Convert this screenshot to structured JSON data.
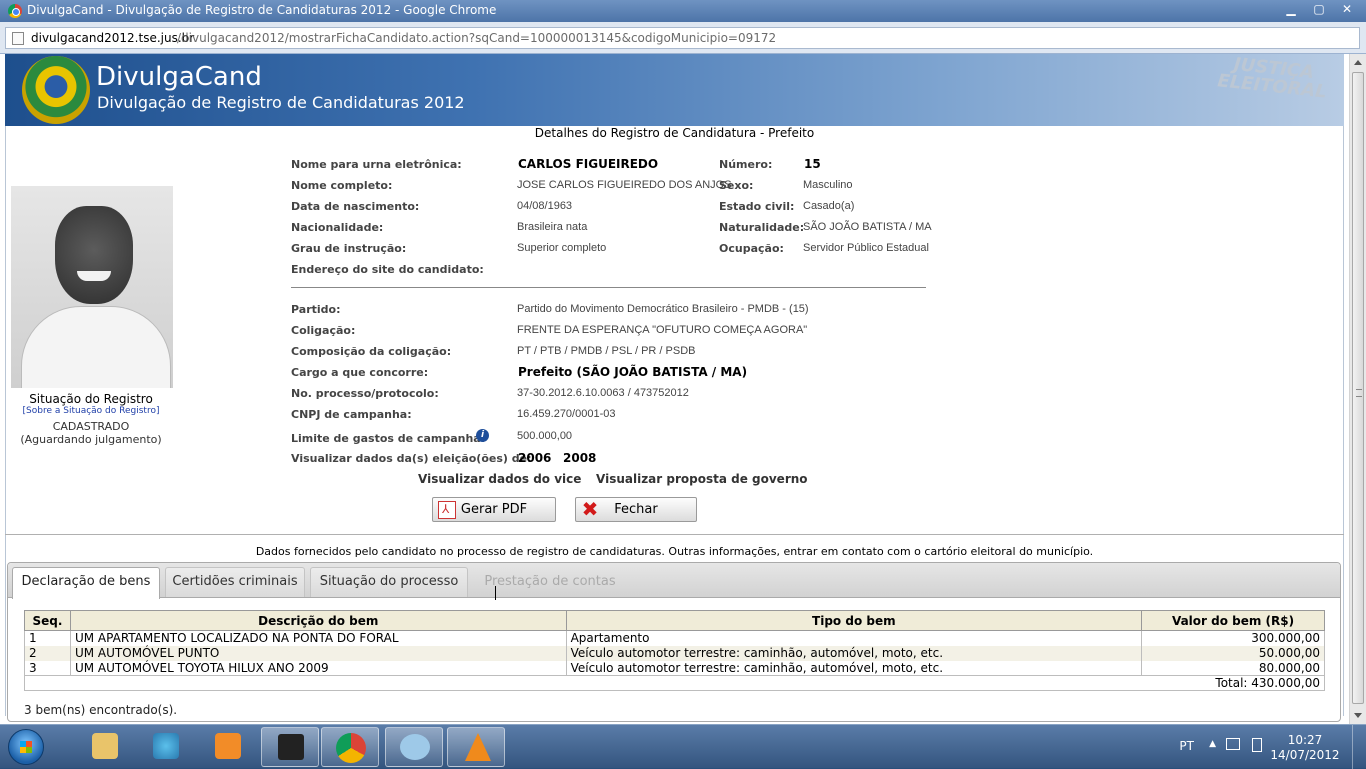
{
  "window": {
    "title": "DivulgaCand - Divulgação de Registro de Candidaturas 2012 - Google Chrome",
    "controls": {
      "minimize": "▁",
      "maximize": "▢",
      "close": "✕"
    }
  },
  "address": {
    "host": "divulgacand2012.tse.jus.br",
    "path": "/divulgacand2012/mostrarFichaCandidato.action?sqCand=100000013145&codigoMunicipio=09172"
  },
  "banner": {
    "app_name": "DivulgaCand",
    "subtitle": "Divulgação de Registro de Candidaturas 2012",
    "brand": "JUSTIÇA ELEITORAL"
  },
  "section_title": "Detalhes do Registro de Candidatura - Prefeito",
  "registration": {
    "title": "Situação do Registro",
    "link": "[Sobre a Situação do Registro]",
    "status": "CADASTRADO",
    "status_note": "(Aguardando julgamento)"
  },
  "candidate": {
    "ballot_name_label": "Nome para urna eletrônica:",
    "ballot_name": "CARLOS FIGUEIREDO",
    "number_label": "Número:",
    "number": "15",
    "full_name_label": "Nome completo:",
    "full_name": "JOSE CARLOS FIGUEIREDO DOS ANJOS",
    "sex_label": "Sexo:",
    "sex": "Masculino",
    "birth_label": "Data de nascimento:",
    "birth": "04/08/1963",
    "civil_label": "Estado civil:",
    "civil": "Casado(a)",
    "nationality_label": "Nacionalidade:",
    "nationality": "Brasileira nata",
    "birthplace_label": "Naturalidade:",
    "birthplace": "SÃO JOÃO BATISTA / MA",
    "education_label": "Grau de instrução:",
    "education": "Superior completo",
    "occupation_label": "Ocupação:",
    "occupation": "Servidor Público Estadual",
    "site_label": "Endereço do site do candidato:",
    "party_label": "Partido:",
    "party": "Partido do Movimento Democrático Brasileiro -  PMDB - (15)",
    "coalition_label": "Coligação:",
    "coalition": "FRENTE DA ESPERANÇA \"OFUTURO COMEÇA AGORA\"",
    "composition_label": "Composição da coligação:",
    "composition": "PT / PTB / PMDB / PSL / PR / PSDB",
    "office_label": "Cargo a que concorre:",
    "office": "Prefeito (SÃO JOÃO BATISTA / MA)",
    "process_label": "No. processo/protocolo:",
    "process": "37-30.2012.6.10.0063 / 473752012",
    "cnpj_label": "CNPJ de campanha:",
    "cnpj": "16.459.270/0001-03",
    "limit_label": "Limite de gastos de campanha:",
    "limit": "500.000,00",
    "elections_label": "Visualizar dados da(s) eleição(ões) de:",
    "elections": [
      "2006",
      "2008"
    ]
  },
  "actions": {
    "vice": "Visualizar dados do vice",
    "proposal": "Visualizar proposta de governo",
    "pdf": "Gerar PDF",
    "close": "Fechar"
  },
  "notice": "Dados fornecidos pelo candidato no processo de registro de candidaturas.  Outras informações, entrar em contato com o cartório eleitoral do município.",
  "tabs": [
    "Declaração de bens",
    "Certidões criminais",
    "Situação do processo",
    "Prestação de contas"
  ],
  "goods_table": {
    "headers": [
      "Seq.",
      "Descrição do bem",
      "Tipo do bem",
      "Valor do bem (R$)"
    ],
    "rows": [
      [
        "1",
        "UM APARTAMENTO LOCALIZADO NA PONTA DO FORAL",
        "Apartamento",
        "300.000,00"
      ],
      [
        "2",
        "UM AUTOMÓVEL PUNTO",
        "Veículo automotor terrestre: caminhão, automóvel, moto, etc.",
        "50.000,00"
      ],
      [
        "3",
        "UM AUTOMÓVEL TOYOTA HILUX ANO 2009",
        "Veículo automotor terrestre: caminhão, automóvel, moto, etc.",
        "80.000,00"
      ]
    ],
    "total": "Total: 430.000,00"
  },
  "found": "3 bem(ns) encontrado(s).",
  "taskbar": {
    "lang": "PT",
    "time": "10:27",
    "date": "14/07/2012"
  }
}
